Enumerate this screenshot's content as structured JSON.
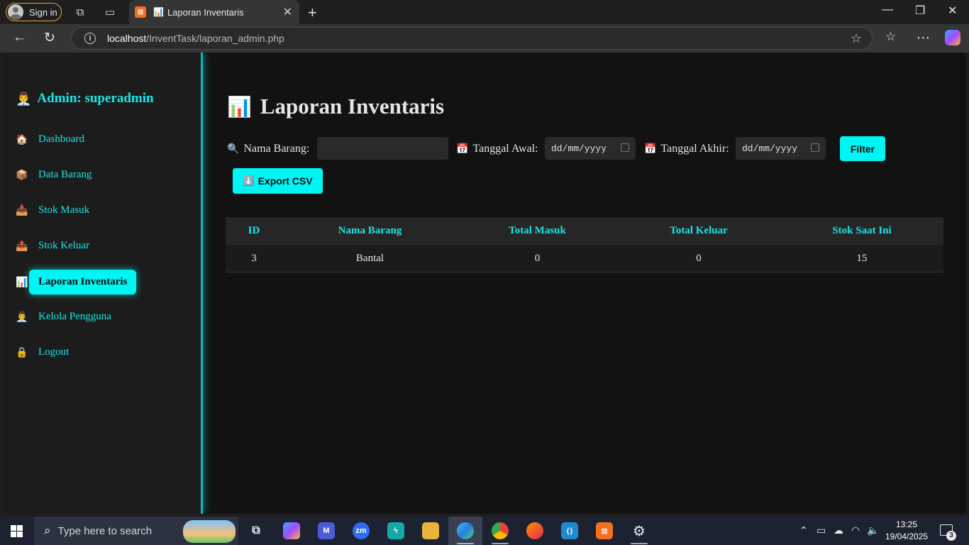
{
  "browser": {
    "signin_label": "Sign in",
    "tab_title": "Laporan Inventaris",
    "tab_favicon": "📊",
    "url_host": "localhost",
    "url_path": "/InventTask/laporan_admin.php"
  },
  "sidebar": {
    "admin_emoji": "👨‍💼",
    "admin_label": "Admin: superadmin",
    "items": [
      {
        "icon": "🏠",
        "label": "Dashboard"
      },
      {
        "icon": "📦",
        "label": "Data Barang"
      },
      {
        "icon": "📥",
        "label": "Stok Masuk"
      },
      {
        "icon": "📤",
        "label": "Stok Keluar"
      },
      {
        "icon": "📊",
        "label": "Laporan Inventaris"
      },
      {
        "icon": "👨‍💼",
        "label": "Kelola Pengguna"
      },
      {
        "icon": "🔒",
        "label": "Logout"
      }
    ]
  },
  "main": {
    "heading_emoji": "📊",
    "heading": "Laporan Inventaris",
    "filters": {
      "nama_icon": "🔍",
      "nama_label": "Nama Barang:",
      "nama_value": "",
      "awal_icon": "📅",
      "awal_label": "Tanggal Awal:",
      "awal_value": "dd/mm/yyyy",
      "akhir_icon": "📅",
      "akhir_label": "Tanggal Akhir:",
      "akhir_value": "dd/mm/yyyy",
      "filter_button": "Filter",
      "export_icon": "⬇️",
      "export_button": "Export CSV"
    },
    "table": {
      "headers": [
        "ID",
        "Nama Barang",
        "Total Masuk",
        "Total Keluar",
        "Stok Saat Ini"
      ],
      "rows": [
        [
          "3",
          "Bantal",
          "0",
          "0",
          "15"
        ]
      ]
    }
  },
  "taskbar": {
    "search_placeholder": "Type here to search",
    "time": "13:25",
    "date": "19/04/2025",
    "notification_count": "3"
  },
  "colors": {
    "accent": "#00f5f5",
    "accent_text": "#19e6e6",
    "page_bg": "#121212",
    "sidebar_bg": "#1c1c1c"
  }
}
